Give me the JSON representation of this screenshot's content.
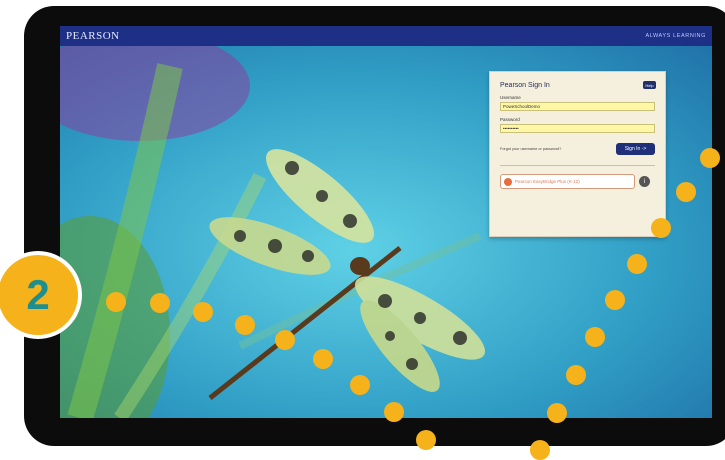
{
  "header": {
    "logo": "PEARSON",
    "tagline": "ALWAYS LEARNING"
  },
  "login": {
    "title": "Pearson Sign In",
    "help_label": "Help",
    "username_label": "Username",
    "username_value": "PoweSchoolDemo",
    "password_label": "Password",
    "password_value": "••••••••••",
    "forgot_text": "Forgot your username or password?",
    "sign_in_label": "Sign In ->",
    "partner_label": "Pearson EasyBridge Plus (K-12)",
    "info_label": "i"
  },
  "callout": {
    "number": "2"
  },
  "colors": {
    "accent": "#f5b21a",
    "header": "#1e2f86",
    "badge_text": "#1f8e8e"
  }
}
